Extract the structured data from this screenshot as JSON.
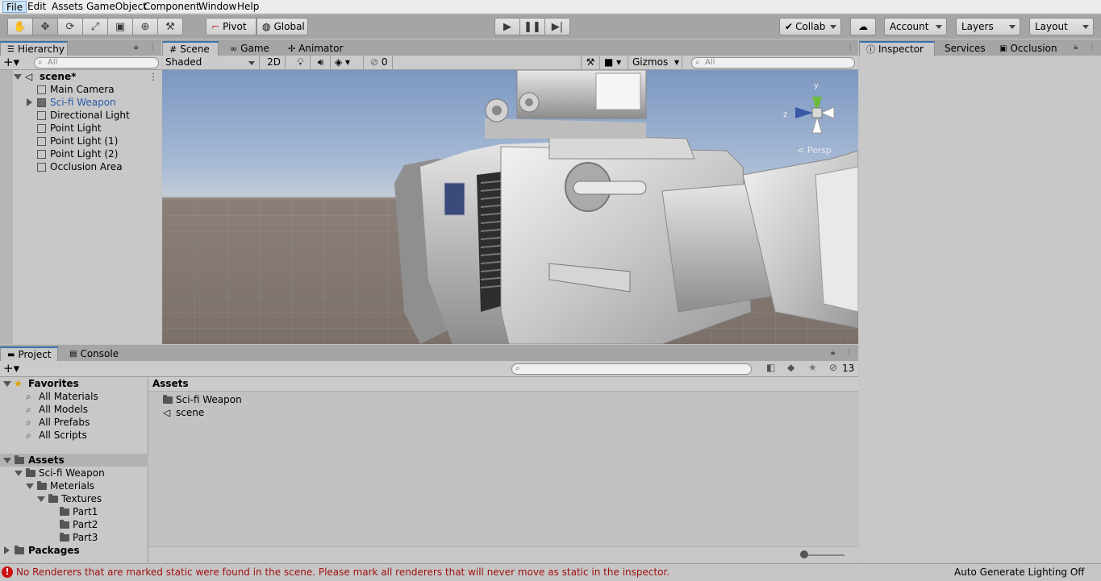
{
  "menu": [
    "File",
    "Edit",
    "Assets",
    "GameObject",
    "Component",
    "Window",
    "Help"
  ],
  "toolbar": {
    "pivot_label": "Pivot",
    "global_label": "Global",
    "collab_label": "Collab",
    "account_label": "Account",
    "layers_label": "Layers",
    "layout_label": "Layout"
  },
  "hierarchy": {
    "tab_label": "Hierarchy",
    "search_placeholder": "All",
    "scene_name": "scene*",
    "items": [
      {
        "label": "Main Camera"
      },
      {
        "label": "Sci-fi Weapon",
        "color": "#2a5aa8"
      },
      {
        "label": "Directional Light"
      },
      {
        "label": "Point Light"
      },
      {
        "label": "Point Light (1)"
      },
      {
        "label": "Point Light (2)"
      },
      {
        "label": "Occlusion Area"
      }
    ]
  },
  "scene": {
    "tabs": [
      "Scene",
      "Game",
      "Animator"
    ],
    "shading_mode": "Shaded",
    "mode_2d": "2D",
    "hidden_count": "0",
    "gizmos_label": "Gizmos",
    "search_placeholder": "All",
    "persp_label": "< Persp",
    "axis_y": "y",
    "axis_z": "z"
  },
  "inspector": {
    "tabs": [
      "Inspector",
      "Services",
      "Occlusion"
    ]
  },
  "project": {
    "tabs": [
      "Project",
      "Console"
    ],
    "hidden_count": "13",
    "favorites_label": "Favorites",
    "favorites": [
      "All Materials",
      "All Models",
      "All Prefabs",
      "All Scripts"
    ],
    "assets_label": "Assets",
    "tree": [
      {
        "label": "Sci-fi Weapon",
        "depth": 1
      },
      {
        "label": "Meterials",
        "depth": 2
      },
      {
        "label": "Textures",
        "depth": 3
      },
      {
        "label": "Part1",
        "depth": 4
      },
      {
        "label": "Part2",
        "depth": 4
      },
      {
        "label": "Part3",
        "depth": 4
      }
    ],
    "packages_label": "Packages",
    "breadcrumb": "Assets",
    "assets": [
      {
        "label": "Sci-fi Weapon",
        "icon": "folder-icon"
      },
      {
        "label": "scene",
        "icon": "unity-scene-icon"
      }
    ]
  },
  "status": {
    "message": "No Renderers that are marked static were found in the scene. Please mark all renderers that will never move as static in the inspector.",
    "lighting": "Auto Generate Lighting Off",
    "error_color": "#cc1111"
  }
}
